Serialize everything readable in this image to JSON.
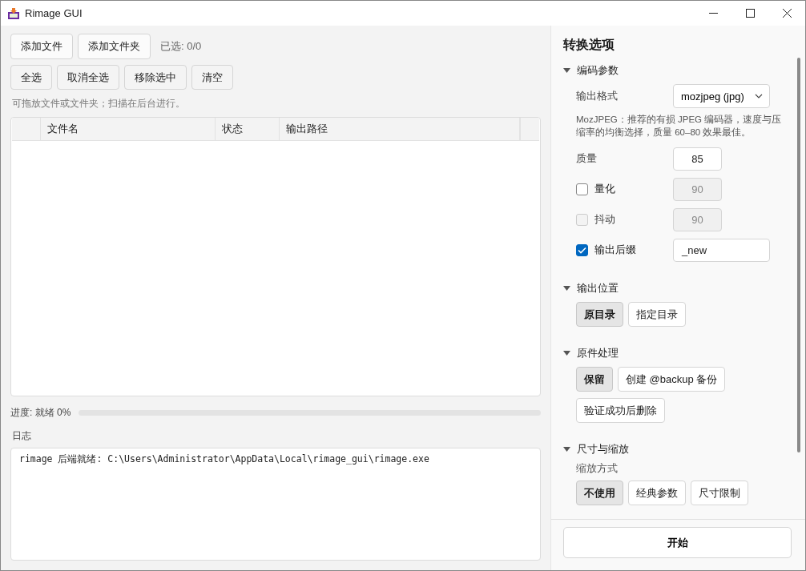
{
  "window": {
    "title": "Rimage GUI"
  },
  "file_actions": {
    "buttons": [
      "添加文件",
      "添加文件夹"
    ],
    "selected_count": "已选: 0/0"
  },
  "selection_actions": {
    "buttons": [
      "全选",
      "取消全选",
      "移除选中",
      "清空"
    ]
  },
  "hint": "可拖放文件或文件夹；扫描在后台进行。",
  "table": {
    "columns": [
      "文件名",
      "状态",
      "输出路径"
    ]
  },
  "progress": {
    "label": "进度: 就绪 0%",
    "level": 0
  },
  "log": {
    "label": "日志",
    "lines": [
      "rimage 后端就绪: C:\\Users\\Administrator\\AppData\\Local\\rimage_gui\\rimage.exe"
    ]
  },
  "options": {
    "title": "转换选项",
    "sections": [
      {
        "title": "编码参数",
        "expanded": true,
        "items": [
          {
            "kind": "select",
            "label": "输出格式",
            "value": "mozjpeg (jpg)"
          },
          {
            "kind": "note",
            "text": "MozJPEG：推荐的有损 JPEG 编码器，速度与压缩率的均衡选择，质量 60–80 效果最佳。"
          },
          {
            "kind": "field",
            "label": "质量",
            "value": "85"
          },
          {
            "kind": "check_field",
            "label": "量化",
            "checked": false,
            "disabled": false,
            "value": "90",
            "field_disabled": true
          },
          {
            "kind": "check_field",
            "label": "抖动",
            "checked": false,
            "disabled": true,
            "value": "90",
            "field_disabled": true
          },
          {
            "kind": "check_field",
            "label": "输出后缀",
            "checked": true,
            "disabled": false,
            "value": "_new",
            "field_disabled": false
          }
        ]
      },
      {
        "title": "输出位置",
        "expanded": true,
        "items": [
          {
            "kind": "choices",
            "options": [
              {
                "label": "原目录",
                "selected": true
              },
              {
                "label": "指定目录",
                "selected": false
              }
            ]
          }
        ]
      },
      {
        "title": "原件处理",
        "expanded": true,
        "items": [
          {
            "kind": "choices",
            "options": [
              {
                "label": "保留",
                "selected": true
              },
              {
                "label": "创建 @backup 备份",
                "selected": false
              },
              {
                "label": "验证成功后删除",
                "selected": false
              }
            ]
          }
        ]
      },
      {
        "title": "尺寸与缩放",
        "expanded": true,
        "items": [
          {
            "kind": "label",
            "text": "缩放方式"
          },
          {
            "kind": "choices",
            "options": [
              {
                "label": "不使用",
                "selected": true
              },
              {
                "label": "经典参数",
                "selected": false
              },
              {
                "label": "尺寸限制",
                "selected": false
              }
            ]
          }
        ]
      }
    ]
  },
  "start_button": "开始"
}
